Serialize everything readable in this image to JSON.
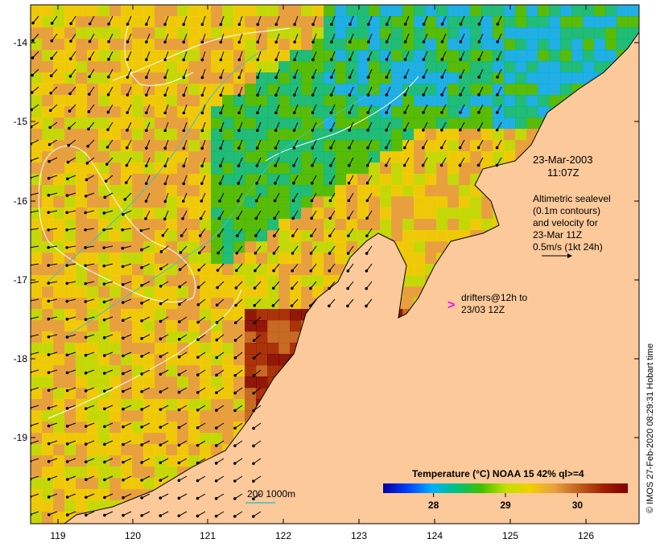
{
  "map": {
    "lon_ticks": [
      "119",
      "120",
      "121",
      "122",
      "123",
      "124",
      "125",
      "126"
    ],
    "lat_ticks": [
      "-14",
      "-15",
      "-16",
      "-17",
      "-18",
      "-19"
    ],
    "land_color": "#fcc99a",
    "coast_color": "#000000",
    "arrow_color": "#000000",
    "contour_color": "#ffffff",
    "isobath_color": "#40c0c0"
  },
  "annotations": {
    "date": "23-Mar-2003",
    "time": "11:07Z",
    "sealevel_lines": [
      "Altimetric sealevel",
      "(0.1m contours)",
      "and velocity for",
      "23-Mar 11Z",
      "0.5m/s (1kt 24h)"
    ],
    "drifter_symbol": ">",
    "drifter_color": "#ff00ff",
    "drifter_lines": [
      "drifters@12h to",
      "23/03 12Z"
    ],
    "isobath_legend": "200  1000m"
  },
  "colorbar": {
    "title": "Temperature (°C) NOAA 15 42% ql>=4",
    "ticks": [
      "28",
      "29",
      "30"
    ],
    "tick_values": [
      28,
      29,
      30
    ],
    "range": [
      27.3,
      30.7
    ],
    "colors": [
      "#0000a0",
      "#0040ff",
      "#00b0ff",
      "#00c080",
      "#40c000",
      "#c0e000",
      "#f0d000",
      "#e8a040",
      "#c06020",
      "#a02000",
      "#800000"
    ]
  },
  "credit": "© IMOS 27-Feb-2020 08:29:31 Hobart time"
}
